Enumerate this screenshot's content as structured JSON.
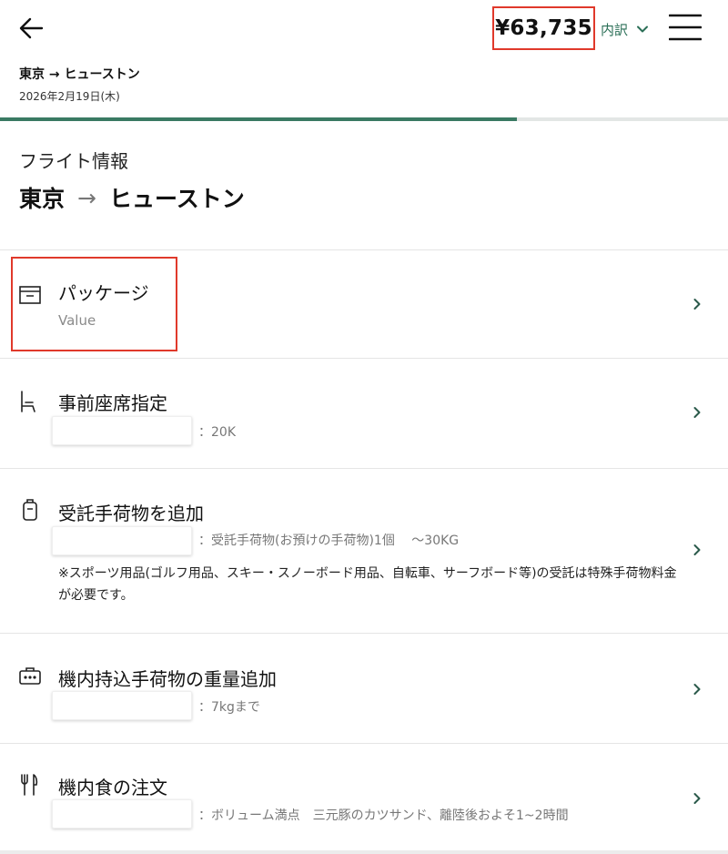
{
  "header": {
    "price": "¥63,735",
    "breakdown_label": "内訳",
    "route": "東京 → ヒューストン",
    "date": "2026年2月19日(木)",
    "progress": 0.71,
    "progress_color": "#3a7a63",
    "highlight_color": "#e0392b",
    "icons": [
      "back-arrow-icon",
      "chevron-down-icon",
      "hamburger-menu-icon"
    ]
  },
  "flight": {
    "section_label": "フライト情報",
    "from": "東京",
    "arrow": "→",
    "to": "ヒューストン"
  },
  "options": [
    {
      "icon": "package-box-icon",
      "title": "パッケージ",
      "value": "Value"
    },
    {
      "icon": "seat-icon",
      "title": "事前座席指定",
      "subtext": "：20K"
    },
    {
      "icon": "suitcase-icon",
      "title": "受託手荷物を追加",
      "subtext": "：受託手荷物(お預けの手荷物)1個　 ～30KG",
      "note": "※スポーツ用品(ゴルフ用品、スキー・スノーボード用品、自転車、サーフボード等)の受託は特殊手荷物料金が必要です。"
    },
    {
      "icon": "carry-on-bag-icon",
      "title": "機内持込手荷物の重量追加",
      "subtext": "：7kgまで"
    },
    {
      "icon": "fork-knife-icon",
      "title": "機内食の注文",
      "subtext": "：ボリューム満点　三元豚のカツサンド、離陸後およそ1~2時間"
    }
  ]
}
